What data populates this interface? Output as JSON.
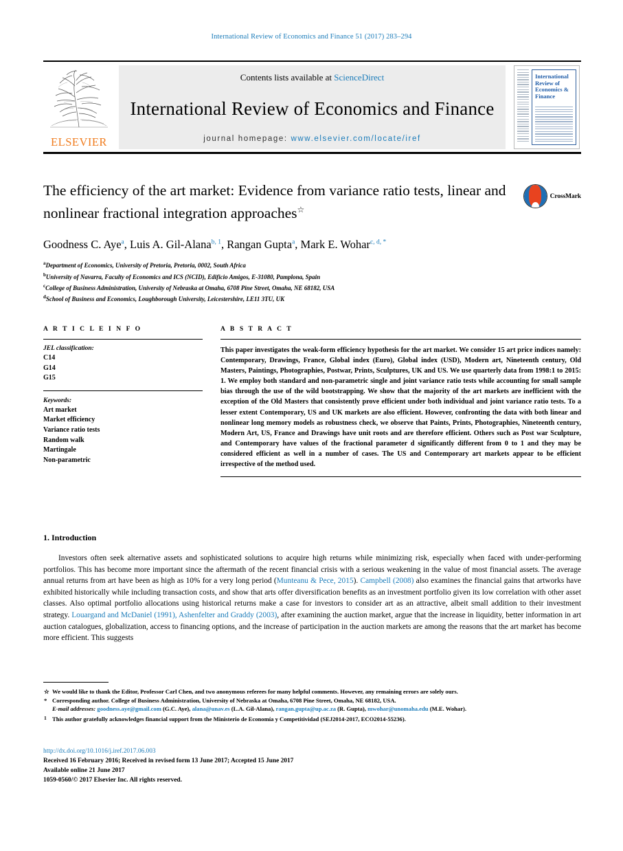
{
  "running_head": "International Review of Economics and Finance 51 (2017) 283–294",
  "masthead": {
    "contents_prefix": "Contents lists available at ",
    "sciencedirect": "ScienceDirect",
    "journal_name": "International Review of Economics and Finance",
    "homepage_prefix": "journal homepage: ",
    "homepage_url": "www.elsevier.com/locate/iref",
    "publisher": "ELSEVIER",
    "cover_title": "International Review of Economics & Finance",
    "accent_blue": "#1a7bb9",
    "elsevier_orange": "#f07c1e"
  },
  "article": {
    "title": "The efficiency of the art market: Evidence from variance ratio tests, linear and nonlinear fractional integration approaches",
    "title_mark": "☆",
    "crossmark_label": "CrossMark",
    "authors": [
      {
        "name": "Goodness C. Aye",
        "marks": "a"
      },
      {
        "name": "Luis A. Gil-Alana",
        "marks": "b, 1"
      },
      {
        "name": "Rangan Gupta",
        "marks": "a"
      },
      {
        "name": "Mark E. Wohar",
        "marks": "c, d, *"
      }
    ],
    "affiliations": [
      {
        "mark": "a",
        "text": "Department of Economics, University of Pretoria, Pretoria, 0002, South Africa"
      },
      {
        "mark": "b",
        "text": "University of Navarra, Faculty of Economics and ICS (NCID), Edificio Amigos, E-31080, Pamplona, Spain"
      },
      {
        "mark": "c",
        "text": "College of Business Administration, University of Nebraska at Omaha, 6708 Pine Street, Omaha, NE 68182, USA"
      },
      {
        "mark": "d",
        "text": "School of Business and Economics, Loughborough University, Leicestershire, LE11 3TU, UK"
      }
    ]
  },
  "article_info": {
    "heading": "A R T I C L E   I N F O",
    "jel_label": "JEL classification:",
    "jel_codes": [
      "C14",
      "G14",
      "G15"
    ],
    "keywords_label": "Keywords:",
    "keywords": [
      "Art market",
      "Market efficiency",
      "Variance ratio tests",
      "Random walk",
      "Martingale",
      "Non-parametric"
    ]
  },
  "abstract": {
    "heading": "A B S T R A C T",
    "text": "This paper investigates the weak-form efficiency hypothesis for the art market. We consider 15 art price indices namely: Contemporary, Drawings, France, Global index (Euro), Global index (USD), Modern art, Nineteenth century, Old Masters, Paintings, Photographies, Postwar, Prints, Sculptures, UK and US. We use quarterly data from 1998:1 to 2015: 1. We employ both standard and non-parametric single and joint variance ratio tests while accounting for small sample bias through the use of the wild bootstrapping. We show that the majority of the art markets are inefficient with the exception of the Old Masters that consistently prove efficient under both individual and joint variance ratio tests. To a lesser extent Contemporary, US and UK markets are also efficient. However, confronting the data with both linear and nonlinear long memory models as robustness check, we observe that Paints, Prints, Photographies, Nineteenth century, Modern Art, US, France and Drawings have unit roots and are therefore efficient. Others such as Post war Sculpture, and Contemporary have values of the fractional parameter d significantly different from 0 to 1 and they may be considered efficient as well in a number of cases. The US and Contemporary art markets appear to be efficient irrespective of the method used."
  },
  "introduction": {
    "section_number_title": "1. Introduction",
    "paragraph_part1": "Investors often seek alternative assets and sophisticated solutions to acquire high returns while minimizing risk, especially when faced with under-performing portfolios. This has become more important since the aftermath of the recent financial crisis with a serious weakening in the value of most financial assets. The average annual returns from art have been as high as 10% for a very long period (",
    "cite1": "Munteanu & Pece, 2015",
    "paragraph_part2": "). ",
    "cite2": "Campbell (2008)",
    "paragraph_part3": " also examines the financial gains that artworks have exhibited historically while including transaction costs, and show that arts offer diversification benefits as an investment portfolio given its low correlation with other asset classes. Also optimal portfolio allocations using historical returns make a case for investors to consider art as an attractive, albeit small addition to their investment strategy. ",
    "cite3": "Louargand and McDaniel (1991), Ashenfelter and Graddy (2003)",
    "paragraph_part4": ", after examining the auction market, argue that the increase in liquidity, better information in art auction catalogues, globalization, access to financing options, and the increase of participation in the auction markets are among the reasons that the art market has become more efficient. This suggests"
  },
  "footnotes": {
    "star_mark": "☆",
    "star_text": "We would like to thank the Editor, Professor Carl Chen, and two anonymous referees for many helpful comments. However, any remaining errors are solely ours.",
    "corr_mark": "*",
    "corr_text": "Corresponding author. College of Business Administration, University of Nebraska at Omaha, 6708 Pine Street, Omaha, NE 68182, USA.",
    "emails_label": "E-mail addresses:",
    "emails": [
      {
        "address": "goodness.aye@gmail.com",
        "owner": "(G.C. Aye)"
      },
      {
        "address": "alana@unav.es",
        "owner": "(L.A. Gil-Alana)"
      },
      {
        "address": "rangan.gupta@up.ac.za",
        "owner": "(R. Gupta)"
      },
      {
        "address": "mwohar@unomaha.edu",
        "owner": "(M.E. Wohar)"
      }
    ],
    "note1_mark": "1",
    "note1_text": "This author gratefully acknowledges financial support from the Ministerio de Economía y Competitividad (SEJ2014-2017, ECO2014-55236)."
  },
  "publication": {
    "doi": "http://dx.doi.org/10.1016/j.iref.2017.06.003",
    "dates": "Received 16 February 2016; Received in revised form 13 June 2017; Accepted 15 June 2017",
    "online": "Available online 21 June 2017",
    "copyright": "1059-0560/© 2017 Elsevier Inc. All rights reserved."
  }
}
